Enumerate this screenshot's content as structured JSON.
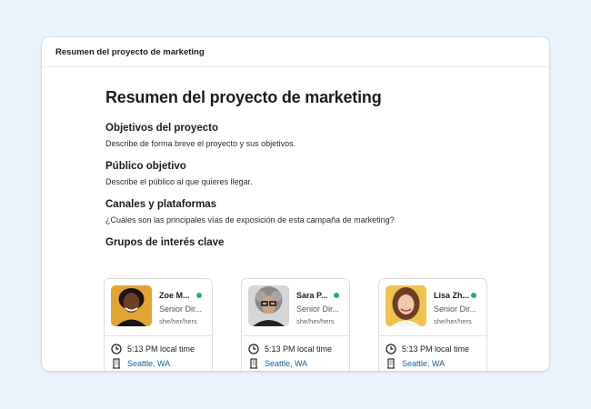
{
  "window": {
    "header_title": "Resumen del proyecto de marketing"
  },
  "doc": {
    "title": "Resumen del proyecto de marketing",
    "sections": [
      {
        "heading": "Objetivos del proyecto",
        "text": "Describe de forma breve el proyecto y sus objetivos."
      },
      {
        "heading": "Público objetivo",
        "text": "Describe el público al que quieres llegar."
      },
      {
        "heading": "Canales y plataformas",
        "text": "¿Cuáles son las principales vías de exposición de esta campaña de marketing?"
      }
    ],
    "stakeholders_heading": "Grupos de interés clave"
  },
  "stakeholders": [
    {
      "name": "Zoe M...",
      "role": "Senior Dir...",
      "pronouns": "she/her/hers",
      "time": "5:13 PM local time",
      "location": "Seattle, WA",
      "presence": "active"
    },
    {
      "name": "Sara P...",
      "role": "Senior Dir...",
      "pronouns": "she/her/hers",
      "time": "5:13 PM local time",
      "location": "Seattle, WA",
      "presence": "active"
    },
    {
      "name": "Lisa Zh...",
      "role": "Senior Dir...",
      "pronouns": "she/her/hers",
      "time": "5:13 PM local time",
      "location": "Seattle, WA",
      "presence": "active"
    }
  ],
  "colors": {
    "background": "#eaf3fc",
    "presence_active": "#2bac76",
    "link": "#1264a3"
  },
  "icons": {
    "time": "clock-icon",
    "location": "building-icon"
  }
}
